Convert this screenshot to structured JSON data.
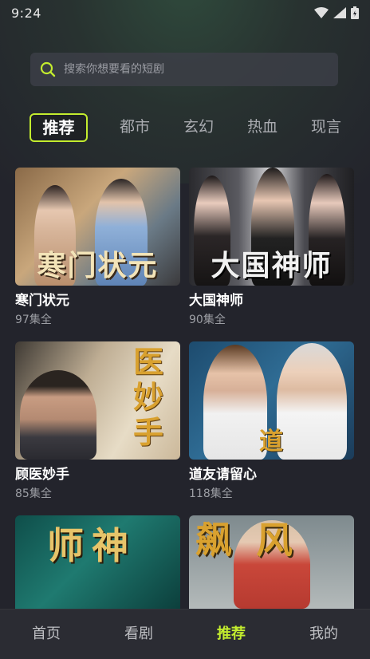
{
  "status_bar": {
    "time": "9:24"
  },
  "search": {
    "placeholder": "搜索你想要看的短剧"
  },
  "tabs": [
    {
      "label": "推荐",
      "active": true
    },
    {
      "label": "都市",
      "active": false
    },
    {
      "label": "玄幻",
      "active": false
    },
    {
      "label": "热血",
      "active": false
    },
    {
      "label": "现言",
      "active": false
    }
  ],
  "dramas": [
    {
      "title": "寒门状元",
      "episodes": "97集全",
      "poster_text": "寒门状元"
    },
    {
      "title": "大国神师",
      "episodes": "90集全",
      "poster_text": "大国神师"
    },
    {
      "title": "顾医妙手",
      "episodes": "85集全",
      "poster_text": "医妙手"
    },
    {
      "title": "道友请留心",
      "episodes": "118集全",
      "poster_text": "道"
    },
    {
      "title": "",
      "episodes": "",
      "poster_text": "师神"
    },
    {
      "title": "",
      "episodes": "",
      "poster_text": "飙风"
    }
  ],
  "bottom_nav": [
    {
      "label": "首页",
      "active": false
    },
    {
      "label": "看剧",
      "active": false
    },
    {
      "label": "推荐",
      "active": true
    },
    {
      "label": "我的",
      "active": false
    }
  ],
  "colors": {
    "accent": "#c3ec2e",
    "background": "#23242c"
  }
}
